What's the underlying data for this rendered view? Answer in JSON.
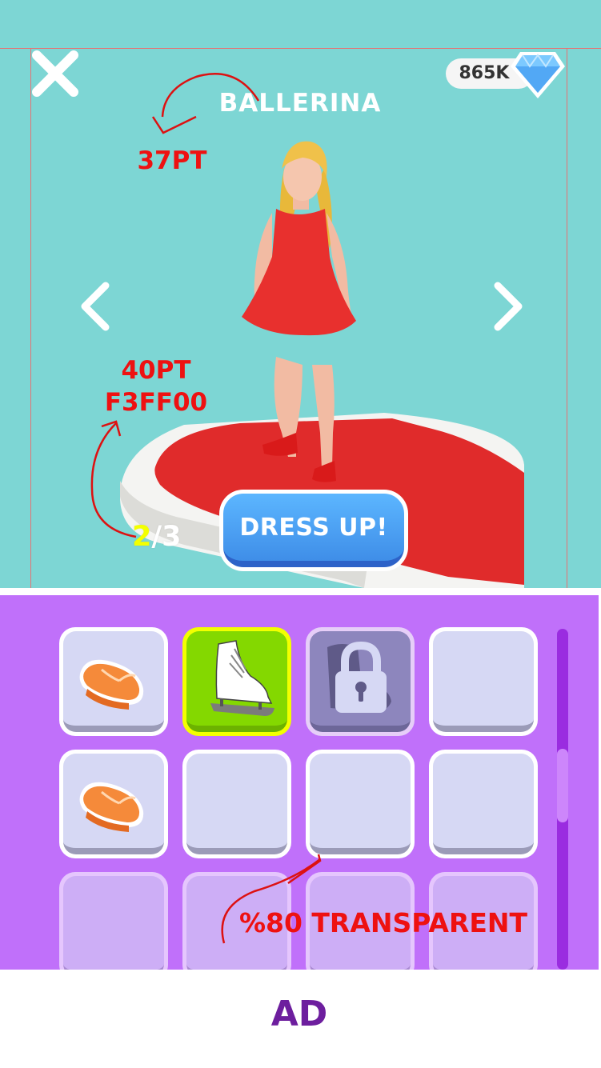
{
  "header": {
    "gem_count": "865K",
    "title": "BALLERINA"
  },
  "annotations": {
    "title_size": "37PT",
    "counter_size": "40PT",
    "counter_color": "F3FF00",
    "slot_transparency": "%80 TRANSPARENT"
  },
  "character": {
    "page_current": "2",
    "page_separator": "/",
    "page_total": "3",
    "dress_up_label": "DRESS UP!"
  },
  "inventory": {
    "slots": [
      {
        "item": "orange-flip-flop-icon",
        "state": "normal"
      },
      {
        "item": "ice-skate-icon",
        "state": "selected"
      },
      {
        "item": "lock-icon",
        "state": "locked"
      },
      {
        "item": "",
        "state": "empty"
      },
      {
        "item": "orange-flip-flop-icon",
        "state": "normal"
      },
      {
        "item": "",
        "state": "empty"
      },
      {
        "item": "",
        "state": "empty"
      },
      {
        "item": "",
        "state": "empty"
      },
      {
        "item": "",
        "state": "faded"
      },
      {
        "item": "",
        "state": "faded"
      },
      {
        "item": "",
        "state": "faded"
      },
      {
        "item": "",
        "state": "faded"
      }
    ]
  },
  "ad": {
    "label": "AD"
  },
  "colors": {
    "scene_bg": "#7dd6d4",
    "panel_bg": "#c070fa",
    "button_blue": "#3f8ee8",
    "selected_slot": "#84d800",
    "counter_highlight": "#f3ff00",
    "annotation_red": "#ee1111",
    "ad_text": "#6d1e9e"
  }
}
